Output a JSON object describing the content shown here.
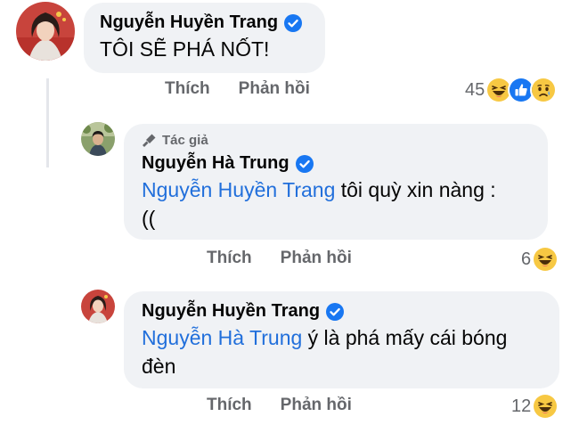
{
  "comments": [
    {
      "author": "Nguyễn Huyền Trang",
      "text": "TÔI SẼ PHÁ NỐT!",
      "actions": {
        "like": "Thích",
        "reply": "Phản hồi"
      },
      "reaction_count": "45",
      "reactions": [
        "haha-icon",
        "like-icon",
        "sad-icon"
      ]
    },
    {
      "badge": "Tác giả",
      "author": "Nguyễn Hà Trung",
      "mention": "Nguyễn Huyền Trang",
      "text_line1": " tôi quỳ xin nàng :",
      "text_line2": "((",
      "actions": {
        "like": "Thích",
        "reply": "Phản hồi"
      },
      "reaction_count": "6",
      "reactions": [
        "haha-icon"
      ]
    },
    {
      "author": "Nguyễn Huyền Trang",
      "mention": "Nguyễn Hà Trung",
      "text_line1": " ý là phá mấy cái bóng",
      "text_line2": "đèn",
      "actions": {
        "like": "Thích",
        "reply": "Phản hồi"
      },
      "reaction_count": "12",
      "reactions": [
        "haha-icon"
      ]
    }
  ],
  "colors": {
    "bubble": "#f0f2f5",
    "mention": "#216fdb",
    "verified": "#1877f2",
    "secondary_text": "#65676b"
  }
}
